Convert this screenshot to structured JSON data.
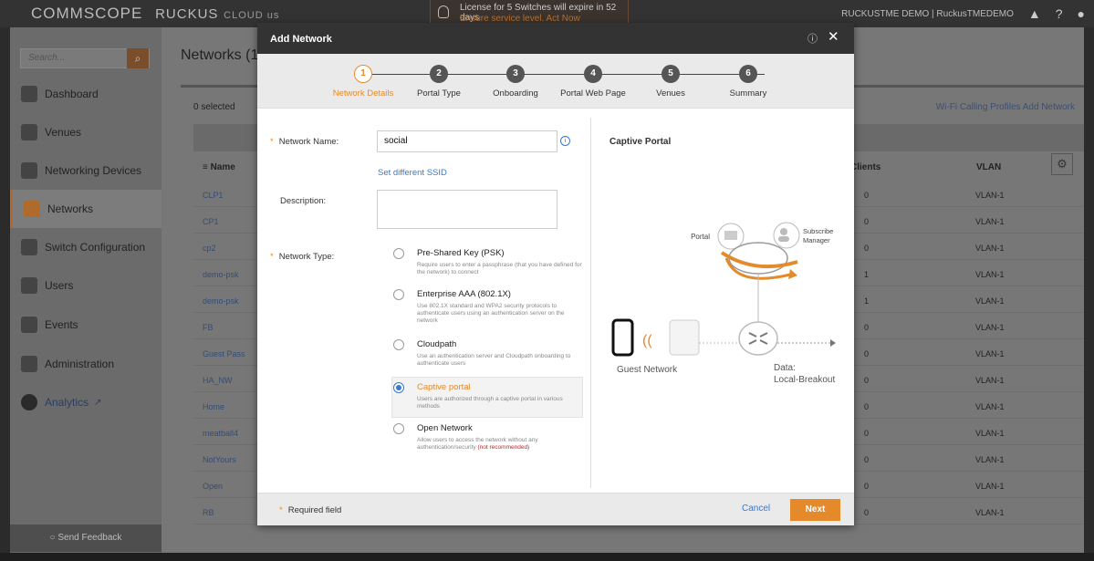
{
  "topbar": {
    "logo_commscope": "COMMSCOPE",
    "logo_ruckus": "RUCKUS",
    "logo_cloud": "CLOUD us",
    "license_line1": "License for 5 Switches will expire in 52 days",
    "license_line2": "Ensure service level. Act Now",
    "tenant": "RUCKUSTME DEMO | RuckusTMEDEMO",
    "bell_icon": "▲",
    "help_icon": "?",
    "user_icon": "●"
  },
  "sidebar": {
    "search_placeholder": "Search...",
    "search_icon": "⌕",
    "items": [
      {
        "label": "Dashboard"
      },
      {
        "label": "Venues"
      },
      {
        "label": "Networking Devices"
      },
      {
        "label": "Networks"
      },
      {
        "label": "Switch Configuration"
      },
      {
        "label": "Users"
      },
      {
        "label": "Events"
      },
      {
        "label": "Administration"
      },
      {
        "label": "Analytics"
      }
    ],
    "feedback": "Send Feedback"
  },
  "main": {
    "title": "Networks (1",
    "selected": "0 selected",
    "links": "Wi-Fi Calling Profiles  Add Network",
    "col_name": "Name",
    "col_clients": "Clients",
    "col_vlan": "VLAN",
    "rows": [
      {
        "name": "CLP1",
        "clients": "0",
        "vlan": "VLAN-1"
      },
      {
        "name": "CP1",
        "clients": "0",
        "vlan": "VLAN-1"
      },
      {
        "name": "cp2",
        "clients": "0",
        "vlan": "VLAN-1"
      },
      {
        "name": "demo-psk",
        "clients": "1",
        "vlan": "VLAN-1"
      },
      {
        "name": "demo-psk",
        "clients": "1",
        "vlan": "VLAN-1"
      },
      {
        "name": "FB",
        "clients": "0",
        "vlan": "VLAN-1"
      },
      {
        "name": "Guest Pass",
        "clients": "0",
        "vlan": "VLAN-1"
      },
      {
        "name": "HA_NW",
        "clients": "0",
        "vlan": "VLAN-1"
      },
      {
        "name": "Home",
        "clients": "0",
        "vlan": "VLAN-1"
      },
      {
        "name": "meatball4",
        "clients": "0",
        "vlan": "VLAN-1"
      },
      {
        "name": "NotYours",
        "clients": "0",
        "vlan": "VLAN-1"
      },
      {
        "name": "Open",
        "clients": "0",
        "vlan": "VLAN-1"
      },
      {
        "name": "RB",
        "clients": "0",
        "vlan": "VLAN-1"
      }
    ]
  },
  "modal": {
    "title": "Add Network",
    "help_icon": "ⓘ",
    "close_icon": "✕",
    "steps": [
      {
        "num": "1",
        "label": "Network Details"
      },
      {
        "num": "2",
        "label": "Portal Type"
      },
      {
        "num": "3",
        "label": "Onboarding"
      },
      {
        "num": "4",
        "label": "Portal Web Page"
      },
      {
        "num": "5",
        "label": "Venues"
      },
      {
        "num": "6",
        "label": "Summary"
      }
    ],
    "network_name_label": "Network Name:",
    "network_name_value": "social",
    "set_ssid": "Set different SSID",
    "description_label": "Description:",
    "network_type_label": "Network Type:",
    "options": [
      {
        "title": "Pre-Shared Key (PSK)",
        "desc": "Require users to enter a passphrase (that you have defined for the network) to connect"
      },
      {
        "title": "Enterprise AAA (802.1X)",
        "desc": "Use 802.1X standard and WPA2 security protocols to authenticate users using an authentication server on the network"
      },
      {
        "title": "Cloudpath",
        "desc": "Use an authentication server and Cloudpath onboarding to authenticate users"
      },
      {
        "title": "Captive portal",
        "desc": "Users are authorized through a captive portal in various methods"
      },
      {
        "title": "Open Network",
        "desc": "Allow users to access the network without any authentication/security",
        "warn": "(not recommended)"
      }
    ],
    "selected_option": 3,
    "captive_portal_title": "Captive Portal",
    "diagram": {
      "portal": "Portal",
      "subscribe_manager_1": "Subscribe",
      "subscribe_manager_2": "Manager",
      "guest_network": "Guest Network",
      "data_1": "Data:",
      "data_2": "Local-Breakout"
    },
    "required_field": "Required field",
    "cancel": "Cancel",
    "next": "Next"
  },
  "colors": {
    "accent": "#e58a2a",
    "link": "#3a78c9"
  }
}
